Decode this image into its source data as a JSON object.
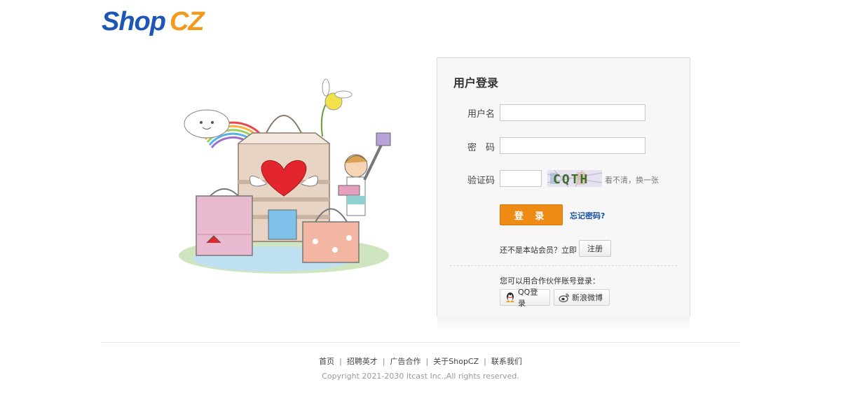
{
  "logo": {
    "shop": "Shop",
    "cz": "CZ"
  },
  "login": {
    "title": "用户登录",
    "username_label": "用户名",
    "password_label": "密　码",
    "captcha_label": "验证码",
    "captcha_text": "CQTH",
    "captcha_refresh": "看不清，换一张",
    "submit_label": "登 录",
    "forgot_label": "忘记密码?",
    "not_member_text": "还不是本站会员？立即",
    "register_label": "注册",
    "partner_text": "您可以用合作伙伴账号登录：",
    "qq_label": "QQ登录",
    "weibo_label": "新浪微博"
  },
  "footer": {
    "links": [
      "首页",
      "招聘英才",
      "广告合作",
      "关于ShopCZ",
      "联系我们"
    ],
    "copyright": "Copyright 2021-2030 itcast Inc.,All rights reserved."
  },
  "colors": {
    "brand_blue": "#1e56b8",
    "brand_orange": "#f39a1c",
    "button_orange": "#ee8b14",
    "link_blue": "#1552a8"
  },
  "icons": {
    "qq": "qq-penguin-icon",
    "weibo": "weibo-eye-icon"
  }
}
